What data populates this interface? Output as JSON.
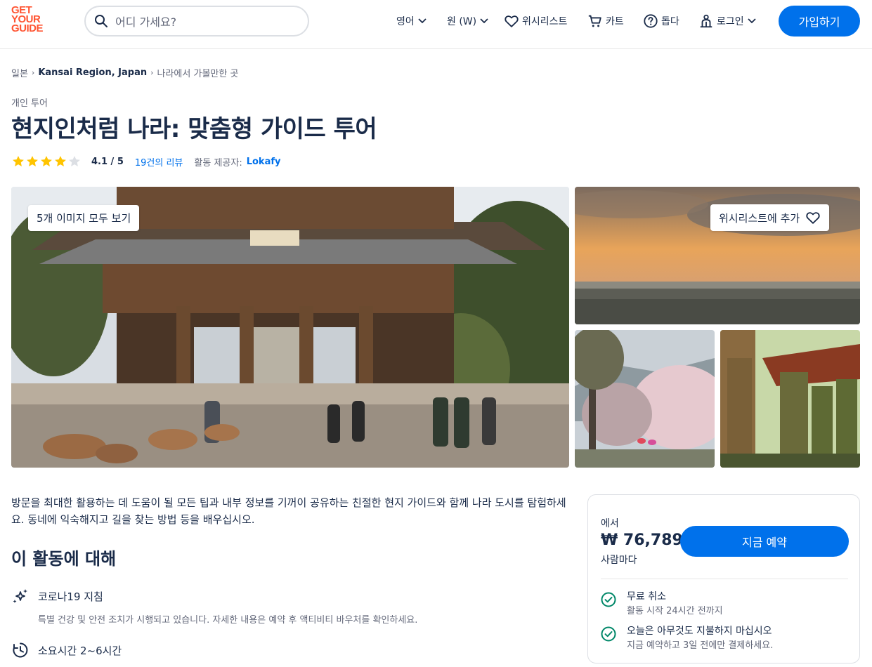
{
  "header": {
    "logo_lines": [
      "GET",
      "YOUR",
      "GUIDE"
    ],
    "search_placeholder": "어디 가세요?",
    "language": "영어",
    "currency": "원 (W)",
    "wishlist": "위시리스트",
    "cart": "카트",
    "help": "돕다",
    "login": "로그인",
    "signup": "가입하기",
    "brand_color": "#ff5533",
    "accent_color": "#0071eb"
  },
  "breadcrumb": [
    "일본",
    "Kansai Region, Japan",
    "나라에서 가볼만한 곳"
  ],
  "category": "개인 투어",
  "title": "현지인처럼 나라: 맞춤형 가이드 투어",
  "rating": {
    "stars_filled": 4,
    "stars_total": 5,
    "score": "4.1 / 5",
    "reviews": "19건의 리뷰",
    "provider_label": "활동 제공자:",
    "provider": "Lokafy"
  },
  "gallery": {
    "see_all": "5개 이미지 모두 보기",
    "wishlist_add": "위시리스트에 추가"
  },
  "description": "방문을 최대한 활용하는 데 도움이 될 모든 팁과 내부 정보를 기꺼이 공유하는 친절한 현지 가이드와 함께 나라 도시를 탐험하세요. 동네에 익숙해지고 길을 찾는 방법 등을 배우십시오.",
  "about": {
    "heading": "이 활동에 대해",
    "covid_title": "코로나19 지침",
    "covid_text": "특별 건강 및 안전 조치가 시행되고 있습니다. 자세한 내용은 예약 후 액티비티 바우처를 확인하세요.",
    "duration": "소요시간 2~6시간"
  },
  "booking": {
    "from": "에서",
    "price": "₩ 76,789",
    "per_person": "사람마다",
    "book_now": "지금 예약",
    "perk1_title": "무료 취소",
    "perk1_sub": "활동 시작 24시간 전까지",
    "perk2_title": "오늘은 아무것도 지불하지 마십시오",
    "perk2_sub": "지금 예약하고 3일 전에만 결제하세요."
  }
}
